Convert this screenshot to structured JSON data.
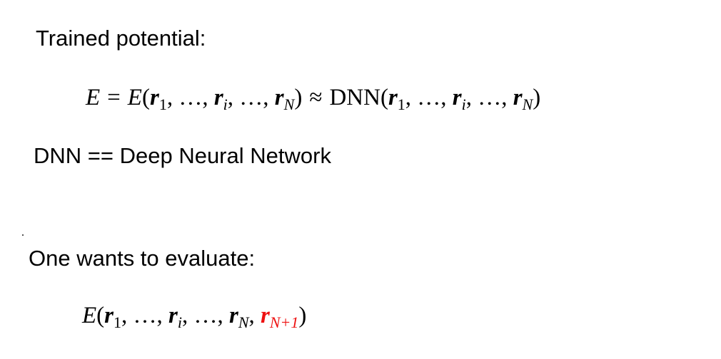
{
  "slide": {
    "heading_trained": "Trained potential:",
    "dnn_definition": "DNN == Deep Neural Network",
    "heading_evaluate": "One wants to evaluate:"
  },
  "eq1": {
    "lhs": "E",
    "equals": "=",
    "func": "E",
    "r": "r",
    "sub1": "1",
    "subi": "i",
    "subN": "N",
    "ellipsis": "…",
    "comma": ",",
    "approx": "≈",
    "dnn": "DNN"
  },
  "eq2": {
    "func": "E",
    "r": "r",
    "sub1": "1",
    "subi": "i",
    "subN": "N",
    "subN1": "N+1",
    "ellipsis": "…",
    "comma": ","
  },
  "colors": {
    "accent": "#ee1111",
    "text": "#000000",
    "background": "#ffffff"
  }
}
